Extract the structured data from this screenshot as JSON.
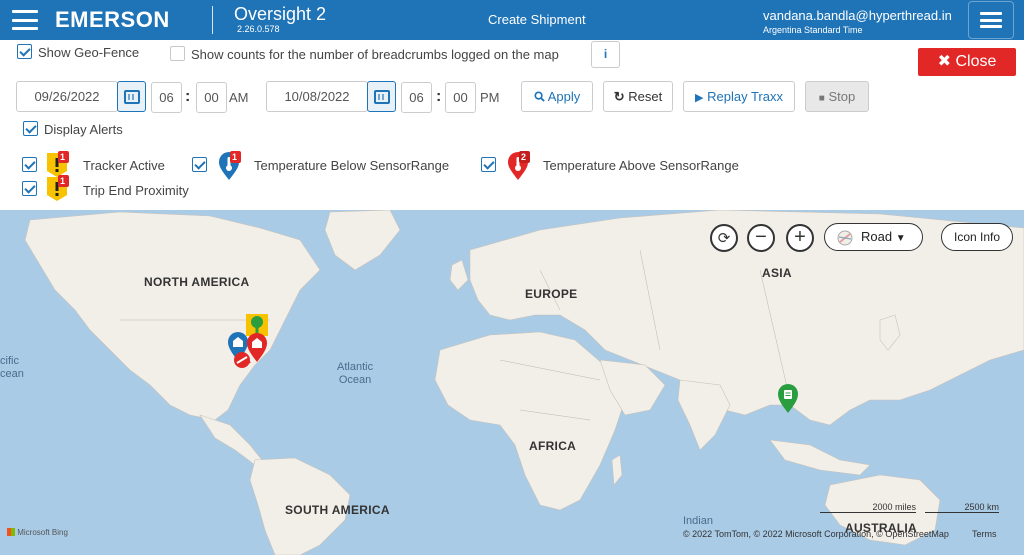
{
  "header": {
    "logo": "EMERSON",
    "app_name": "Oversight 2",
    "app_version": "2.26.0.578",
    "page_title": "Create Shipment",
    "user": "vandana.bandla@hyperthread.in",
    "timezone": "Argentina Standard Time"
  },
  "options": {
    "show_geofence": {
      "label": "Show Geo-Fence",
      "checked": true
    },
    "show_counts": {
      "label": "Show counts for the number of breadcrumbs logged on the map",
      "checked": false
    },
    "info_label": "i",
    "close_label": "Close"
  },
  "timerange": {
    "start_date": "09/26/2022",
    "start_hour": "06",
    "start_minute": "00",
    "start_ampm": "AM",
    "end_date": "10/08/2022",
    "end_hour": "06",
    "end_minute": "00",
    "end_ampm": "PM",
    "apply_label": "Apply",
    "reset_label": "Reset",
    "replay_label": "Replay Traxx",
    "stop_label": "Stop"
  },
  "alerts": {
    "display_alerts": {
      "label": "Display Alerts",
      "checked": true
    },
    "items": [
      {
        "label": "Tracker Active",
        "count": "1",
        "checked": true
      },
      {
        "label": "Temperature Below SensorRange",
        "count": "1",
        "checked": true
      },
      {
        "label": "Temperature Above SensorRange",
        "count": "2",
        "checked": true
      },
      {
        "label": "Trip End Proximity",
        "count": "1",
        "checked": true
      }
    ]
  },
  "map": {
    "style_label": "Road",
    "icon_info_label": "Icon Info",
    "labels": {
      "north_america": "NORTH AMERICA",
      "europe": "EUROPE",
      "asia": "ASIA",
      "africa": "AFRICA",
      "south_america": "SOUTH AMERICA",
      "australia": "AUSTRALIA",
      "atlantic_1": "Atlantic",
      "atlantic_2": "Ocean",
      "pacific_1": "cific",
      "pacific_2": "cean",
      "indian": "Indian"
    },
    "scale_miles": "2000 miles",
    "scale_km": "2500 km",
    "copyright": "© 2022 TomTom, © 2022 Microsoft Corporation, © OpenStreetMap",
    "terms": "Terms",
    "attribution": "Microsoft Bing",
    "colors": {
      "water": "#aacbe6",
      "land": "#f2efe9",
      "header": "#1f73b7",
      "close": "#e12827"
    }
  }
}
